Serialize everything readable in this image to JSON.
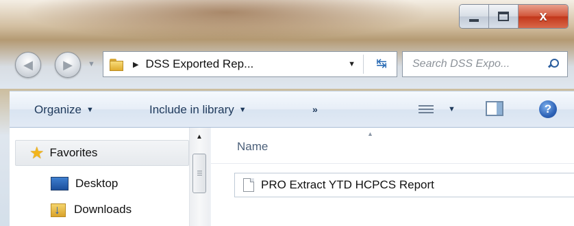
{
  "window": {
    "caption_buttons": [
      {
        "name": "minimize-icon"
      },
      {
        "name": "maximize-icon"
      },
      {
        "name": "close-icon",
        "label": "x"
      }
    ]
  },
  "nav": {
    "back_icon": "back-arrow-icon",
    "forward_icon": "forward-arrow-icon",
    "address": {
      "breadcrumb": "DSS Exported Rep...",
      "folder_icon": "folder-icon"
    },
    "search": {
      "placeholder": "Search DSS Expo..."
    }
  },
  "command_bar": {
    "organize": "Organize",
    "include_in_library": "Include in library",
    "more": "»",
    "help": "?"
  },
  "navigation_pane": {
    "items": [
      {
        "label": "Favorites",
        "icon": "star-icon"
      },
      {
        "label": "Desktop",
        "icon": "desktop-icon"
      },
      {
        "label": "Downloads",
        "icon": "downloads-icon"
      }
    ]
  },
  "file_list": {
    "column_name": "Name",
    "files": [
      {
        "name": "PRO Extract YTD HCPCS Report",
        "icon": "document-icon"
      }
    ]
  },
  "colors": {
    "command_text": "#1e395b",
    "close_button": "#c2371b",
    "accent_blue": "#2b6cb5"
  }
}
